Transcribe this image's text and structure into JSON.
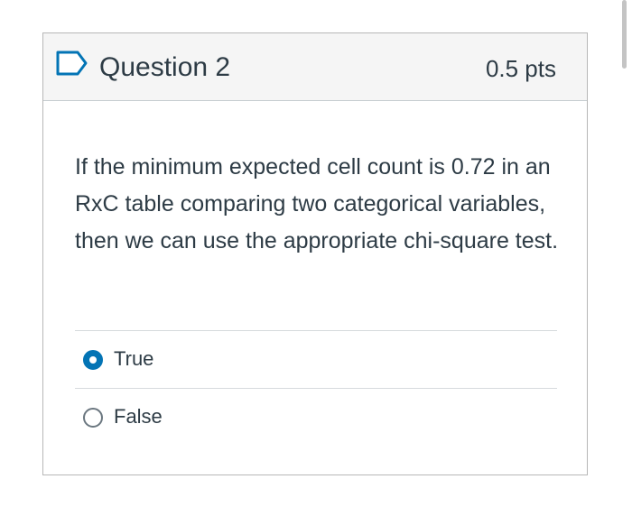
{
  "question": {
    "title": "Question 2",
    "points": "0.5 pts",
    "flag_icon": "bookmark-flag-icon",
    "text": "If the minimum expected cell count is 0.72 in an RxC table comparing two categorical variables, then we can use the appropriate chi-square test.",
    "answers": [
      {
        "label": "True",
        "selected": true
      },
      {
        "label": "False",
        "selected": false
      }
    ]
  },
  "colors": {
    "header_background": "#f5f5f5",
    "text": "#2d3b45",
    "selected_radio": "#0374b5",
    "border": "#b7b7b7"
  }
}
